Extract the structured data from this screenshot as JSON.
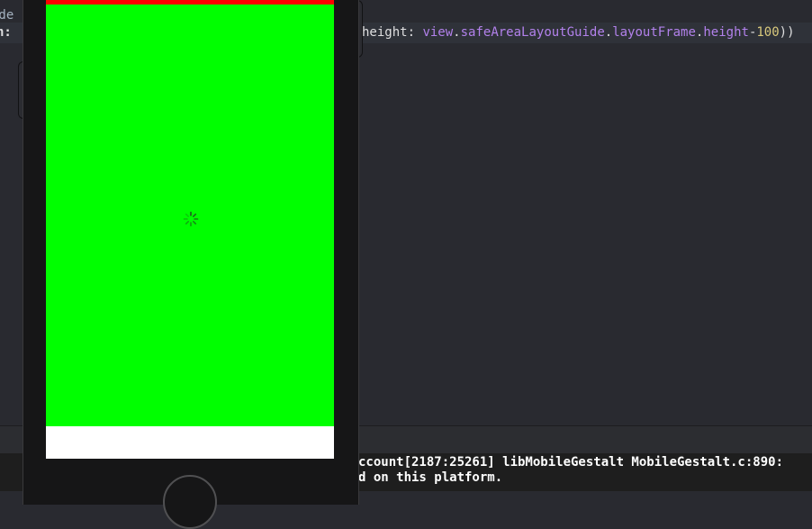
{
  "editor": {
    "line1_fragment": "ide",
    "line2_fragment": "n:",
    "code": {
      "height_label": "height:",
      "view": "view",
      "dot1": ".",
      "safe_area": "safeAreaLayoutGuide",
      "dot2": ".",
      "layout_frame": "layoutFrame",
      "dot3": ".",
      "height_prop": "height",
      "minus": "-",
      "number": "100",
      "closing": "))"
    }
  },
  "console": {
    "line1": "ccount[2187:25261] libMobileGestalt MobileGestalt.c:890:",
    "line2": "d on this platform."
  },
  "simulator": {
    "screen_top_color": "#ff0000",
    "screen_main_color": "#00ff00",
    "screen_bottom_color": "#ffffff",
    "activity_indicator": "spinner-icon"
  },
  "theme": {
    "editor_bg": "#292a30",
    "keyword_color": "#b281eb",
    "number_color": "#d9c97c"
  }
}
